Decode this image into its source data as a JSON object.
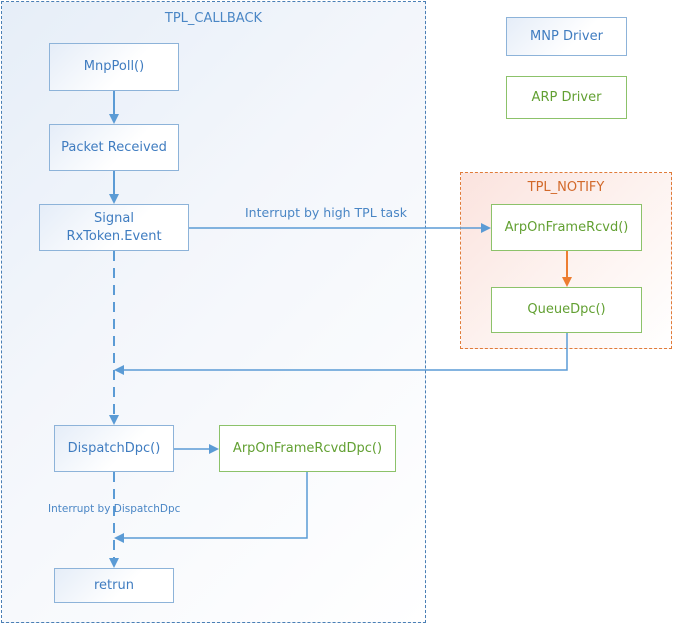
{
  "containers": {
    "callback": {
      "label": "TPL_CALLBACK"
    },
    "notify": {
      "label": "TPL_NOTIFY"
    }
  },
  "legend": {
    "mnp": "MNP Driver",
    "arp": "ARP Driver"
  },
  "nodes": {
    "mnp_poll": "MnpPoll()",
    "packet_received": "Packet Received",
    "signal_line1": "Signal",
    "signal_line2": "RxToken.Event",
    "arp_on_frame_rcvd": "ArpOnFrameRcvd()",
    "queue_dpc": "QueueDpc()",
    "dispatch_dpc": "DispatchDpc()",
    "arp_on_frame_rcvd_dpc": "ArpOnFrameRcvdDpc()",
    "retrun": "retrun"
  },
  "edge_labels": {
    "interrupt_high_tpl": "Interrupt by high TPL task",
    "interrupt_dispatch": "Interrupt by DispatchDpc"
  },
  "colors": {
    "mnp_blue": "#3f7cc0",
    "arp_green": "#62a032",
    "notify_orange": "#e07b39",
    "arrow_blue": "#5b9bd5"
  }
}
